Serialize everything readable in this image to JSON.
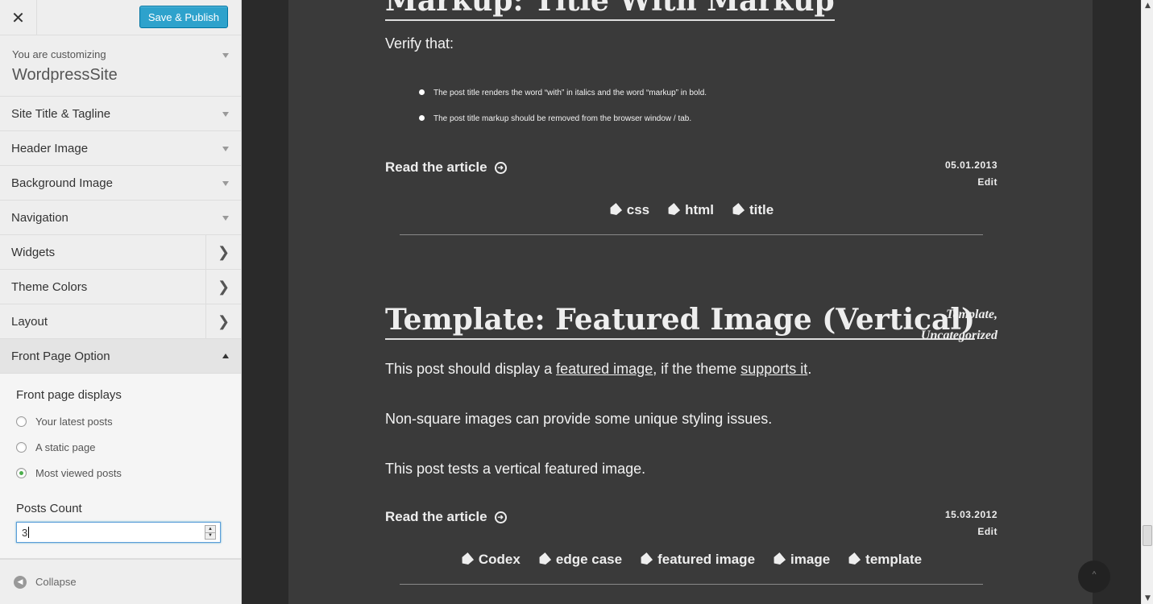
{
  "sidebar": {
    "close_label": "✕",
    "publish_label": "Save & Publish",
    "customizing_label": "You are customizing",
    "site_name": "WordpressSite",
    "sections": [
      {
        "label": "Site Title & Tagline"
      },
      {
        "label": "Header Image"
      },
      {
        "label": "Background Image"
      },
      {
        "label": "Navigation"
      }
    ],
    "panels": [
      {
        "label": "Widgets"
      },
      {
        "label": "Theme Colors"
      },
      {
        "label": "Layout"
      }
    ],
    "open_section": {
      "label": "Front Page Option",
      "field_title": "Front page displays",
      "options": [
        {
          "label": "Your latest posts",
          "checked": false
        },
        {
          "label": "A static page",
          "checked": false
        },
        {
          "label": "Most viewed posts",
          "checked": true
        }
      ],
      "posts_count_label": "Posts Count",
      "posts_count_value": "3"
    },
    "collapse_label": "Collapse"
  },
  "preview": {
    "post1": {
      "title": "Markup: Title With Markup",
      "verify": "Verify that:",
      "bullets": [
        "The post title renders the word “with” in italics and the word “markup” in bold.",
        "The post title markup should be removed from the browser window / tab."
      ],
      "read_more": "Read the article",
      "date": "05.01.2013",
      "edit": "Edit",
      "tags": [
        "css",
        "html",
        "title"
      ]
    },
    "post2": {
      "title": "Template: Featured Image (Vertical)",
      "categories": [
        "Template,",
        "Uncategorized"
      ],
      "para1_before": "This post should display a ",
      "para1_link1": "featured image",
      "para1_middle": ", if the theme ",
      "para1_link2": "supports it",
      "para1_after": ".",
      "para2": "Non-square images can provide some unique styling issues.",
      "para3": "This post tests a vertical featured image.",
      "read_more": "Read the article",
      "date": "15.03.2012",
      "edit": "Edit",
      "tags": [
        "Codex",
        "edge case",
        "featured image",
        "image",
        "template"
      ]
    }
  },
  "colors": {
    "publish": "#2ea2cc",
    "preview_bg": "#3a3a3a",
    "radio_checked": "#4cae4c"
  }
}
